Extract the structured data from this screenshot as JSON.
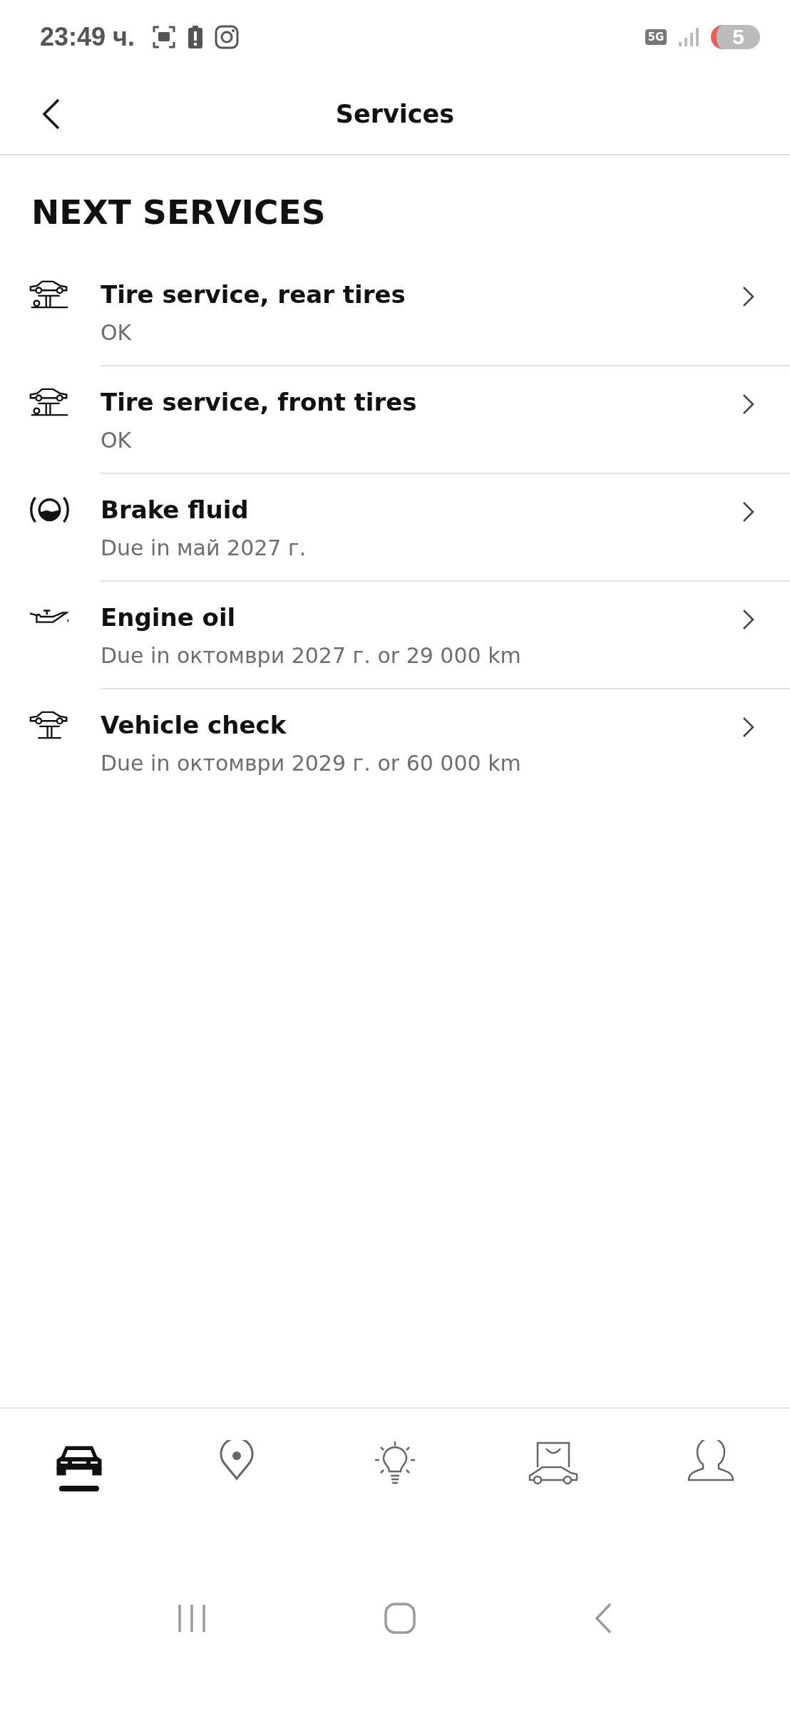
{
  "status_bar": {
    "time": "23:49 ч.",
    "network": "5G",
    "notifications": "5"
  },
  "header": {
    "title": "Services"
  },
  "section_title": "NEXT SERVICES",
  "services": [
    {
      "kind": "tire",
      "title": "Tire service, rear tires",
      "status": "OK"
    },
    {
      "kind": "tire",
      "title": "Tire service, front tires",
      "status": "OK"
    },
    {
      "kind": "brake",
      "title": "Brake fluid",
      "status": "Due in май 2027 г."
    },
    {
      "kind": "oil",
      "title": "Engine oil",
      "status": "Due in октомври 2027 г. or 29 000 km"
    },
    {
      "kind": "lift",
      "title": "Vehicle check",
      "status": "Due in октомври 2029 г. or 60 000 km"
    }
  ],
  "nav_tabs": [
    {
      "kind": "car",
      "selected": true
    },
    {
      "kind": "map",
      "selected": false
    },
    {
      "kind": "ideas",
      "selected": false
    },
    {
      "kind": "shop",
      "selected": false
    },
    {
      "kind": "profile",
      "selected": false
    }
  ]
}
